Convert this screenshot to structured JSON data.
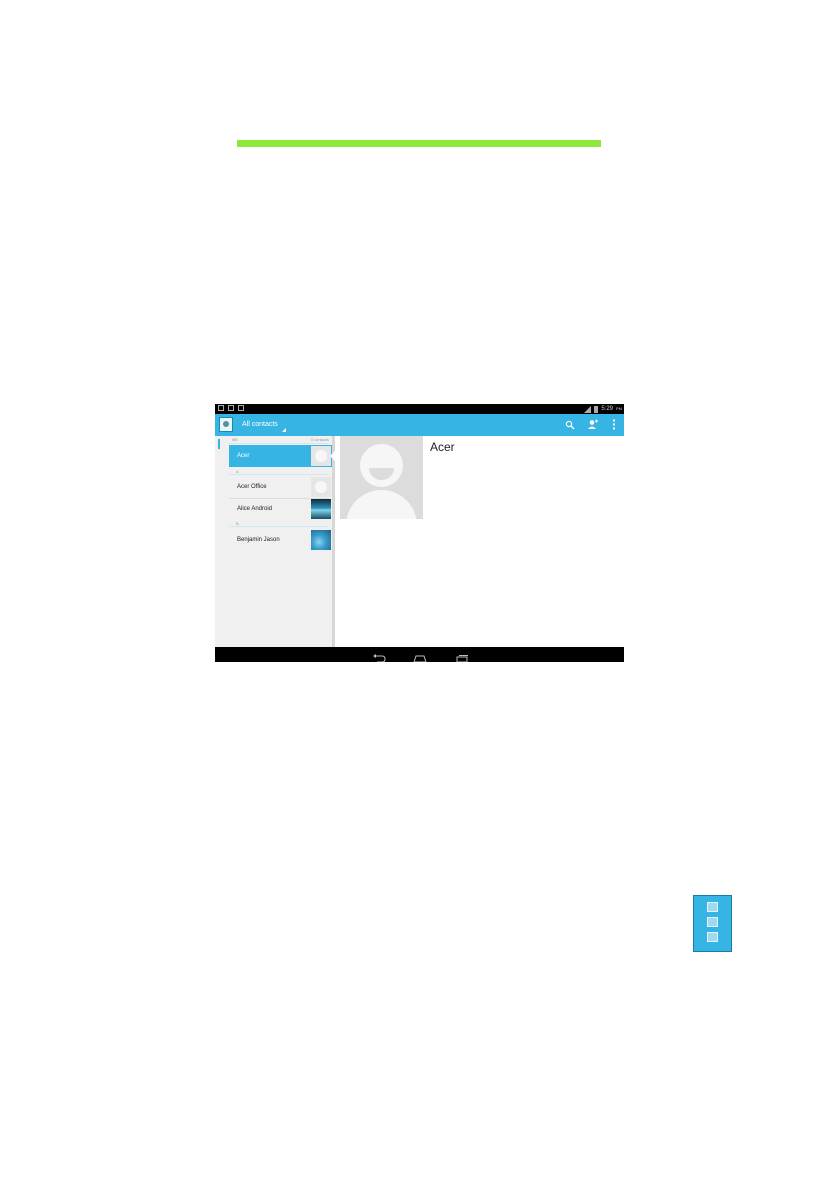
{
  "colors": {
    "green_rule": "#8ee83b",
    "accent": "#36b4e3"
  },
  "statusbar": {
    "time": "5:29",
    "ampm": "PM",
    "icons": [
      "wifi-icon",
      "signal-icon",
      "battery-icon"
    ]
  },
  "actionbar": {
    "title": "All contacts",
    "actions": [
      "search-icon",
      "add-contact-icon",
      "overflow-menu-icon"
    ]
  },
  "list": {
    "me_header": "ME",
    "me_count": "0 contacts",
    "selected": {
      "name": "Acer"
    },
    "section_a": "A",
    "section_b": "B",
    "contacts": [
      {
        "name": "Acer Office",
        "thumb": "default"
      },
      {
        "name": "Alice Android",
        "thumb": "photo"
      },
      {
        "name": "Benjamin Jason",
        "thumb": "photo"
      }
    ]
  },
  "detail": {
    "name": "Acer"
  },
  "navbar": {
    "buttons": [
      "back-icon",
      "home-icon",
      "recent-apps-icon"
    ]
  },
  "menu_icon": {
    "name": "menu-icon"
  }
}
